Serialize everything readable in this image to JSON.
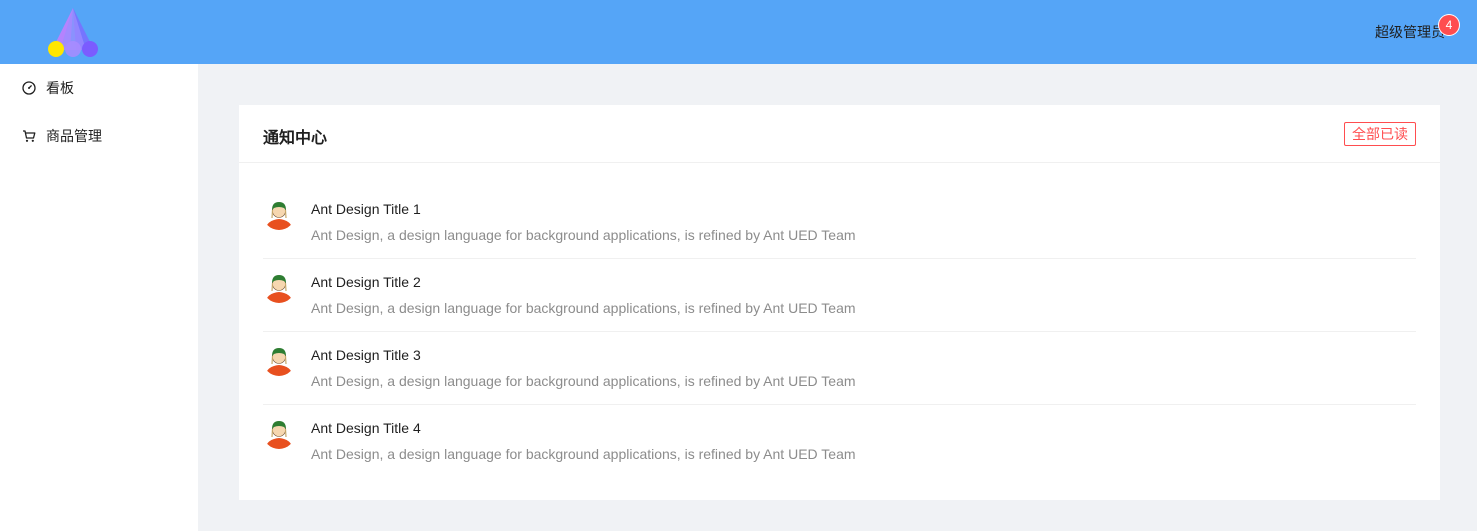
{
  "header": {
    "user_name": "超级管理员",
    "notification_count": "4"
  },
  "sidebar": {
    "items": [
      {
        "label": "看板",
        "icon": "dashboard-icon"
      },
      {
        "label": "商品管理",
        "icon": "shopping-cart-icon"
      }
    ]
  },
  "notice_center": {
    "title": "通知中心",
    "read_all_label": "全部已读",
    "items": [
      {
        "title": "Ant Design Title 1",
        "description": "Ant Design, a design language for background applications, is refined by Ant UED Team"
      },
      {
        "title": "Ant Design Title 2",
        "description": "Ant Design, a design language for background applications, is refined by Ant UED Team"
      },
      {
        "title": "Ant Design Title 3",
        "description": "Ant Design, a design language for background applications, is refined by Ant UED Team"
      },
      {
        "title": "Ant Design Title 4",
        "description": "Ant Design, a design language for background applications, is refined by Ant UED Team"
      }
    ]
  },
  "colors": {
    "header_bg": "#55a5f7",
    "danger": "#ff4d4f"
  }
}
